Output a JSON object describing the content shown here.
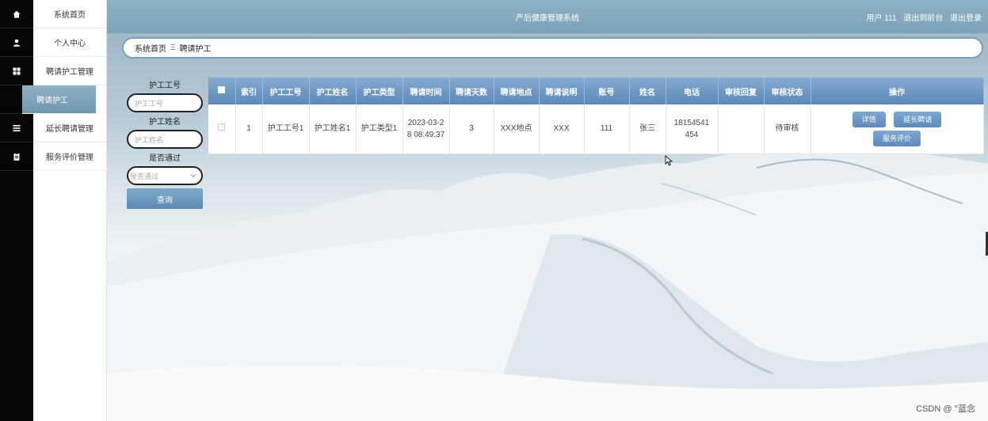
{
  "app": {
    "title": "产后健康管理系统",
    "user_label": "用户 111",
    "back_to_front": "退出到前台",
    "logout": "退出登录"
  },
  "menu": {
    "items": [
      {
        "label": "系统首页",
        "icon": "home-icon"
      },
      {
        "label": "个人中心",
        "icon": "user-icon"
      },
      {
        "label": "聘请护工管理",
        "icon": "grid-icon"
      },
      {
        "label": "聘请护工",
        "icon": ""
      },
      {
        "label": "延长聘请管理",
        "icon": "list-icon"
      },
      {
        "label": "服务评价管理",
        "icon": "clipboard-icon"
      }
    ]
  },
  "breadcrumb": {
    "home": "系统首页",
    "separator": "Ξ",
    "current": "聘请护工"
  },
  "search": {
    "worker_no_label": "护工工号",
    "worker_no_placeholder": "护工工号",
    "worker_name_label": "护工姓名",
    "worker_name_placeholder": "护工姓名",
    "approved_label": "是否通过",
    "approved_placeholder": "是否通过",
    "query_button": "查询"
  },
  "table": {
    "headers": [
      "索引",
      "护工工号",
      "护工姓名",
      "护工类型",
      "聘请时间",
      "聘请天数",
      "聘请地点",
      "聘请说明",
      "账号",
      "姓名",
      "电话",
      "审核回复",
      "审核状态",
      "操作"
    ],
    "rows": [
      {
        "index": "1",
        "worker_no": "护工工号1",
        "worker_name": "护工姓名1",
        "worker_type": "护工类型1",
        "hire_time": "2023-03-28 08:49:37",
        "hire_days": "3",
        "hire_place": "XXX地点",
        "hire_note": "XXX",
        "account": "111",
        "name": "张三",
        "phone": "18154541454",
        "review_reply": "",
        "review_status": "待审核",
        "actions": {
          "detail": "详情",
          "extend": "延长聘请",
          "review": "服务评价"
        }
      }
    ]
  },
  "watermark": "CSDN @ °蓝念",
  "colors": {
    "header_gradient_top": "#8fb3c6",
    "table_header": "#5c87b8",
    "sidebar_strip": "#060606"
  }
}
